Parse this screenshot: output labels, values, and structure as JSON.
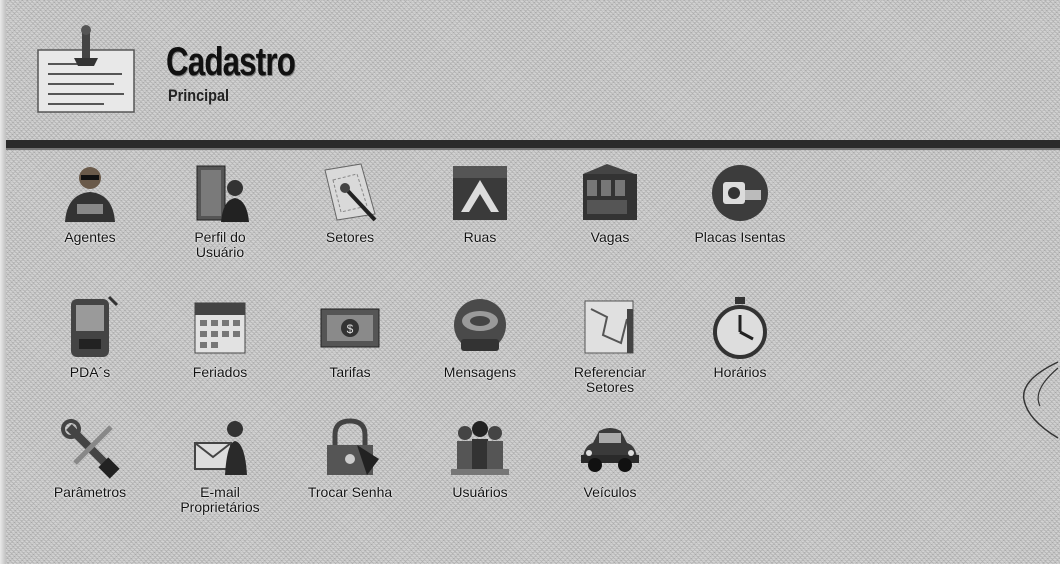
{
  "header": {
    "title": "Cadastro",
    "subtitle": "Principal",
    "icon": "document-form-icon"
  },
  "menu": {
    "rows": [
      [
        {
          "label": "Agentes",
          "icon": "agent-icon"
        },
        {
          "label": "Perfil do\nUsuário",
          "icon": "user-profile-icon"
        },
        {
          "label": "Setores",
          "icon": "sectors-icon"
        },
        {
          "label": "Ruas",
          "icon": "streets-icon"
        },
        {
          "label": "Vagas",
          "icon": "parking-spots-icon"
        },
        {
          "label": "Placas Isentas",
          "icon": "exempt-plates-icon"
        }
      ],
      [
        {
          "label": "PDA´s",
          "icon": "pda-icon"
        },
        {
          "label": "Feriados",
          "icon": "calendar-icon"
        },
        {
          "label": "Tarifas",
          "icon": "money-icon"
        },
        {
          "label": "Mensagens",
          "icon": "messages-icon"
        },
        {
          "label": "Referenciar\nSetores",
          "icon": "map-icon"
        },
        {
          "label": "Horários",
          "icon": "clock-icon"
        }
      ],
      [
        {
          "label": "Parâmetros",
          "icon": "tools-icon"
        },
        {
          "label": "E-mail\nProprietários",
          "icon": "email-icon"
        },
        {
          "label": "Trocar Senha",
          "icon": "lock-icon"
        },
        {
          "label": "Usuários",
          "icon": "users-icon"
        },
        {
          "label": "Veículos",
          "icon": "vehicle-icon"
        }
      ]
    ]
  }
}
